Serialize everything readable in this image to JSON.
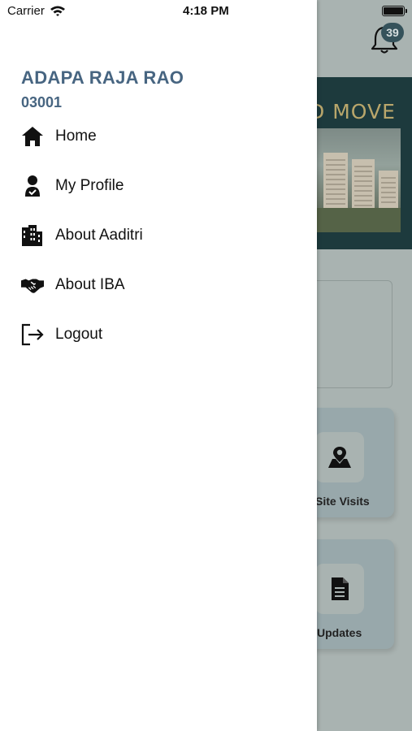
{
  "status_bar": {
    "carrier": "Carrier",
    "time": "4:18 PM"
  },
  "user": {
    "name": "ADAPA RAJA RAO",
    "id": "03001"
  },
  "menu": [
    {
      "label": "Home",
      "icon": "home-icon"
    },
    {
      "label": "My Profile",
      "icon": "profile-icon"
    },
    {
      "label": "About Aaditri",
      "icon": "building-icon"
    },
    {
      "label": "About IBA",
      "icon": "handshake-icon"
    },
    {
      "label": "Logout",
      "icon": "logout-icon"
    }
  ],
  "background": {
    "notification_count": "39",
    "banner_text": "D MOVE",
    "tiles": [
      {
        "label": "Site Visits",
        "icon": "map-pin-user-icon"
      },
      {
        "label": "Updates",
        "icon": "document-icon"
      }
    ]
  },
  "colors": {
    "accent": "#476581",
    "overlay": "#a9b3b1",
    "banner": "#1d3a3d",
    "badge": "#35525b"
  }
}
